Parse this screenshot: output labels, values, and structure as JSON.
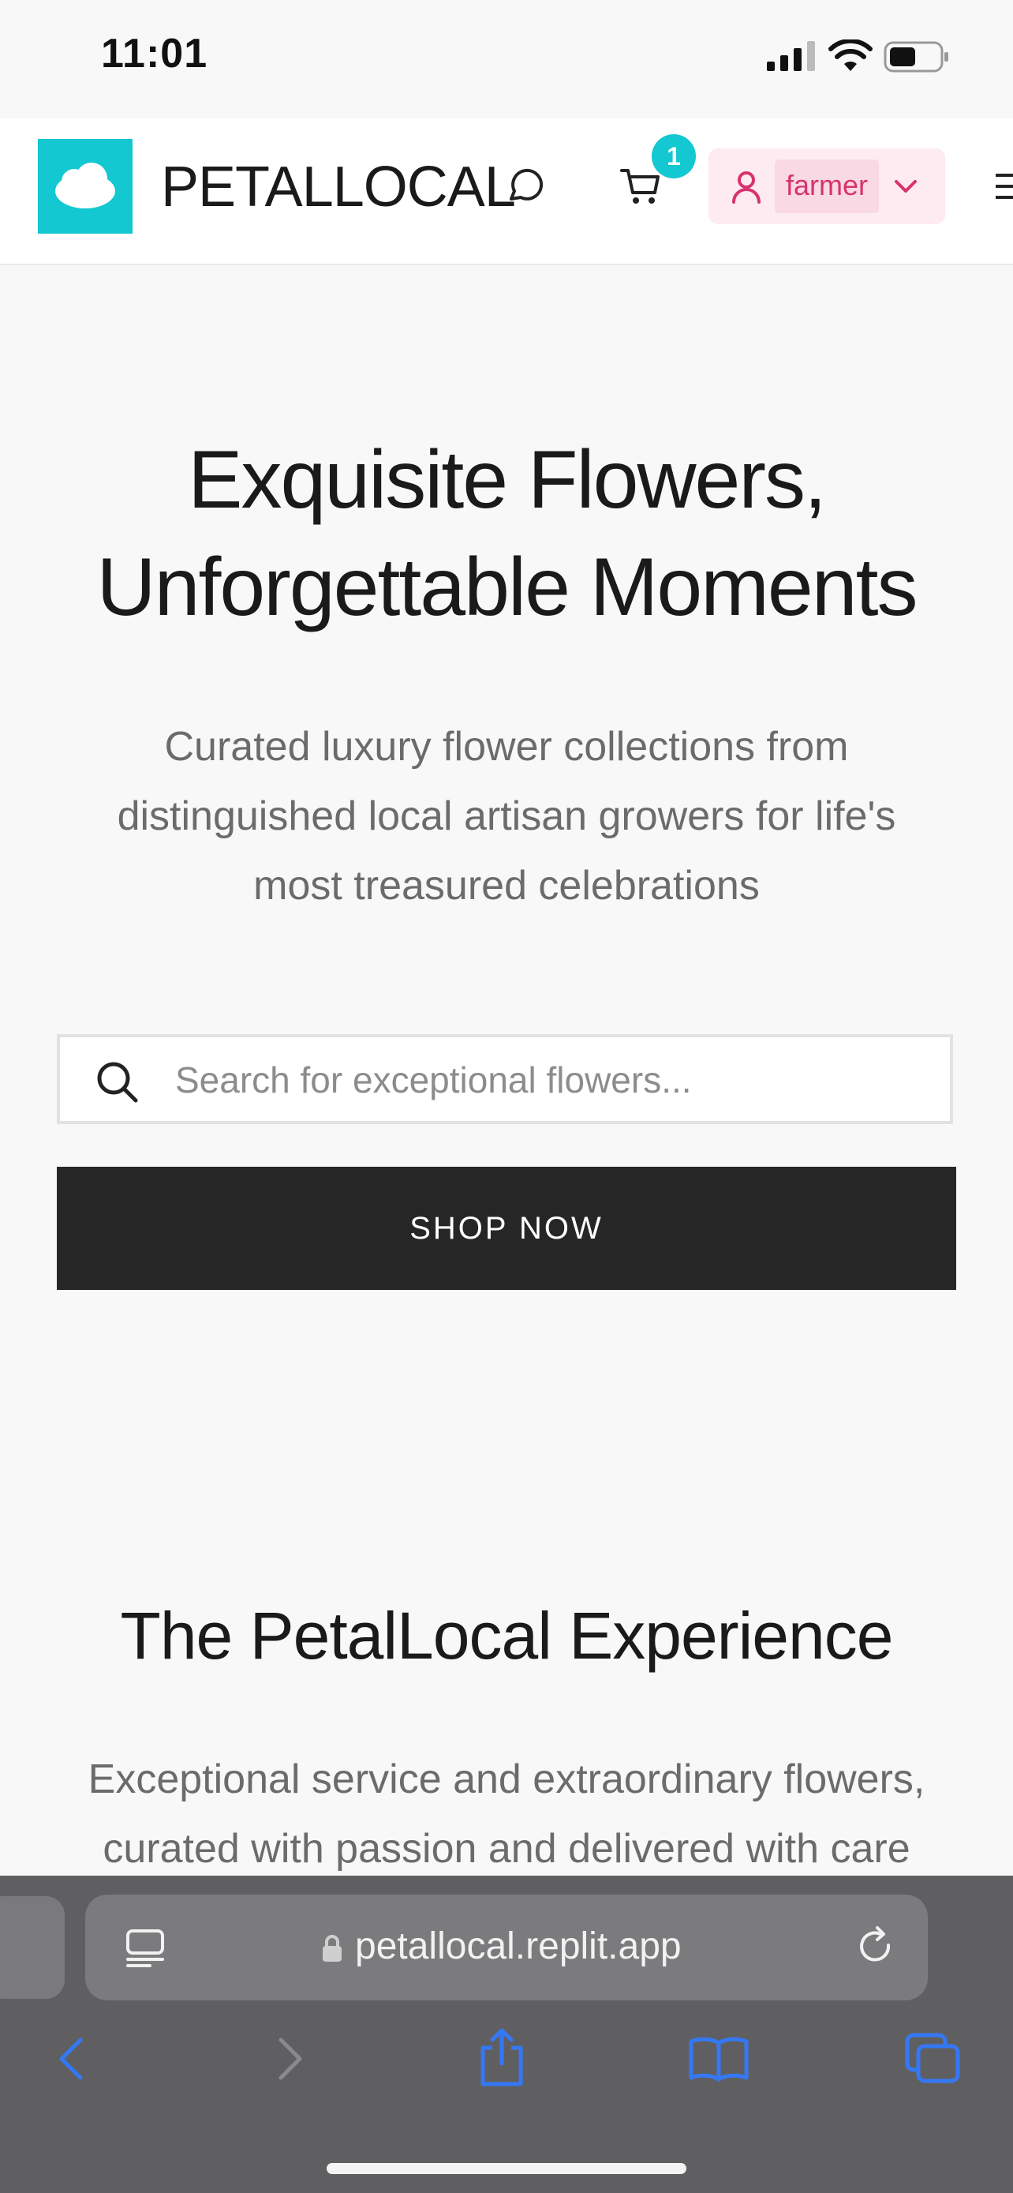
{
  "status_bar": {
    "time": "11:01"
  },
  "header": {
    "brand": "PETALLOCAL",
    "cart_count": "1",
    "user_name": "farmer"
  },
  "hero": {
    "title_line1": "Exquisite Flowers,",
    "title_line2": "Unforgettable Moments",
    "subtitle_line1": "Curated luxury flower collections from",
    "subtitle_line2": "distinguished local artisan growers for life's",
    "subtitle_line3": "most treasured celebrations",
    "search_placeholder": "Search for exceptional flowers...",
    "shop_button": "SHOP NOW"
  },
  "experience": {
    "title": "The PetalLocal Experience",
    "subtitle_line1": "Exceptional service and extraordinary flowers,",
    "subtitle_line2": "curated with passion and delivered with care"
  },
  "browser": {
    "url": "petallocal.replit.app"
  },
  "colors": {
    "accent": "#13c8d0",
    "user_pink": "#d7336e",
    "button_dark": "#262626",
    "ios_blue": "#3478f6"
  },
  "icons": [
    "cloud-icon",
    "chat-icon",
    "cart-icon",
    "user-icon",
    "chevron-down-icon",
    "menu-icon",
    "search-icon",
    "reader-icon",
    "lock-icon",
    "reload-icon",
    "back-icon",
    "forward-icon",
    "share-icon",
    "bookmarks-icon",
    "tabs-icon"
  ]
}
